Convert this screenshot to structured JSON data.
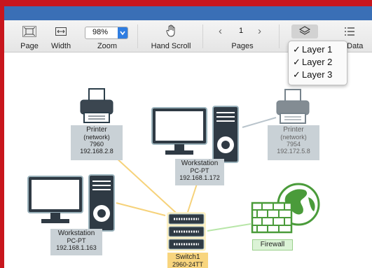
{
  "toolbar": {
    "page_label": "Page",
    "width_label": "Width",
    "zoom_value": "98%",
    "zoom_label": "Zoom",
    "hand_scroll_label": "Hand Scroll",
    "page_number": "1",
    "pages_label": "Pages",
    "data_label": "e Data"
  },
  "layer_menu": {
    "items": [
      {
        "check": "✓",
        "label": "Layer 1"
      },
      {
        "check": "✓",
        "label": "Layer 2"
      },
      {
        "check": "✓",
        "label": "Layer 3"
      }
    ]
  },
  "diagram": {
    "printer1": {
      "name": "Printer",
      "type": "(network)",
      "model": "7960",
      "ip": "192.168.2.8"
    },
    "printer2": {
      "name": "Printer",
      "type": "(network)",
      "model": "7954",
      "ip": "192.172.5.8"
    },
    "workstation_top": {
      "name": "Workstation",
      "model": "PC-PT",
      "ip": "192.168.1.172"
    },
    "workstation_left": {
      "name": "Workstation",
      "model": "PC-PT",
      "ip": "192.168.1.163"
    },
    "switch": {
      "name": "Switch1",
      "model": "2960-24TT"
    },
    "firewall": {
      "name": "Firewall"
    }
  },
  "colors": {
    "title_bar": "#3a6fb6",
    "frame": "#c8161d",
    "link_yellow": "#f6d27a",
    "link_gray": "#b9c4cc",
    "link_green": "#b8e6a8"
  }
}
